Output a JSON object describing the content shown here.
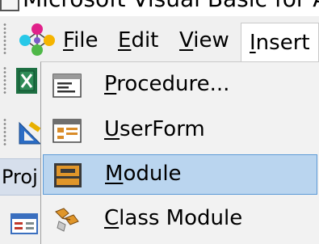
{
  "window": {
    "title": "Microsoft Visual Basic for A"
  },
  "menubar": {
    "items": [
      {
        "accel": "F",
        "rest": "ile"
      },
      {
        "accel": "E",
        "rest": "dit"
      },
      {
        "accel": "V",
        "rest": "iew"
      },
      {
        "accel": "I",
        "rest": "nsert"
      }
    ]
  },
  "project": {
    "label": "Proj"
  },
  "insert_menu": {
    "items": [
      {
        "accel": "P",
        "rest": "rocedure...",
        "icon": "procedure-icon"
      },
      {
        "accel": "U",
        "rest": "serForm",
        "icon": "userform-icon"
      },
      {
        "accel": "M",
        "rest": "odule",
        "icon": "module-icon",
        "highlighted": true
      },
      {
        "accel": "C",
        "rest": "lass Module",
        "icon": "class-module-icon"
      }
    ]
  },
  "colors": {
    "highlight": "#bad5ef",
    "highlight_border": "#5c9ad6",
    "menu_bg": "#f2f2f2"
  }
}
